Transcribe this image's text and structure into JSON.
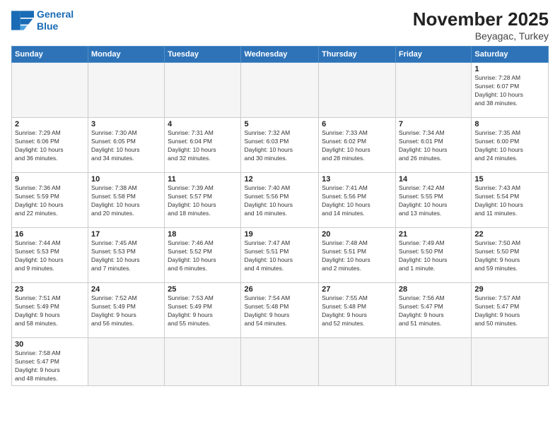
{
  "logo": {
    "line1": "General",
    "line2": "Blue"
  },
  "title": "November 2025",
  "location": "Beyagac, Turkey",
  "weekdays": [
    "Sunday",
    "Monday",
    "Tuesday",
    "Wednesday",
    "Thursday",
    "Friday",
    "Saturday"
  ],
  "weeks": [
    [
      {
        "day": "",
        "info": ""
      },
      {
        "day": "",
        "info": ""
      },
      {
        "day": "",
        "info": ""
      },
      {
        "day": "",
        "info": ""
      },
      {
        "day": "",
        "info": ""
      },
      {
        "day": "",
        "info": ""
      },
      {
        "day": "1",
        "info": "Sunrise: 7:28 AM\nSunset: 6:07 PM\nDaylight: 10 hours\nand 38 minutes."
      }
    ],
    [
      {
        "day": "2",
        "info": "Sunrise: 7:29 AM\nSunset: 6:06 PM\nDaylight: 10 hours\nand 36 minutes."
      },
      {
        "day": "3",
        "info": "Sunrise: 7:30 AM\nSunset: 6:05 PM\nDaylight: 10 hours\nand 34 minutes."
      },
      {
        "day": "4",
        "info": "Sunrise: 7:31 AM\nSunset: 6:04 PM\nDaylight: 10 hours\nand 32 minutes."
      },
      {
        "day": "5",
        "info": "Sunrise: 7:32 AM\nSunset: 6:03 PM\nDaylight: 10 hours\nand 30 minutes."
      },
      {
        "day": "6",
        "info": "Sunrise: 7:33 AM\nSunset: 6:02 PM\nDaylight: 10 hours\nand 28 minutes."
      },
      {
        "day": "7",
        "info": "Sunrise: 7:34 AM\nSunset: 6:01 PM\nDaylight: 10 hours\nand 26 minutes."
      },
      {
        "day": "8",
        "info": "Sunrise: 7:35 AM\nSunset: 6:00 PM\nDaylight: 10 hours\nand 24 minutes."
      }
    ],
    [
      {
        "day": "9",
        "info": "Sunrise: 7:36 AM\nSunset: 5:59 PM\nDaylight: 10 hours\nand 22 minutes."
      },
      {
        "day": "10",
        "info": "Sunrise: 7:38 AM\nSunset: 5:58 PM\nDaylight: 10 hours\nand 20 minutes."
      },
      {
        "day": "11",
        "info": "Sunrise: 7:39 AM\nSunset: 5:57 PM\nDaylight: 10 hours\nand 18 minutes."
      },
      {
        "day": "12",
        "info": "Sunrise: 7:40 AM\nSunset: 5:56 PM\nDaylight: 10 hours\nand 16 minutes."
      },
      {
        "day": "13",
        "info": "Sunrise: 7:41 AM\nSunset: 5:56 PM\nDaylight: 10 hours\nand 14 minutes."
      },
      {
        "day": "14",
        "info": "Sunrise: 7:42 AM\nSunset: 5:55 PM\nDaylight: 10 hours\nand 13 minutes."
      },
      {
        "day": "15",
        "info": "Sunrise: 7:43 AM\nSunset: 5:54 PM\nDaylight: 10 hours\nand 11 minutes."
      }
    ],
    [
      {
        "day": "16",
        "info": "Sunrise: 7:44 AM\nSunset: 5:53 PM\nDaylight: 10 hours\nand 9 minutes."
      },
      {
        "day": "17",
        "info": "Sunrise: 7:45 AM\nSunset: 5:53 PM\nDaylight: 10 hours\nand 7 minutes."
      },
      {
        "day": "18",
        "info": "Sunrise: 7:46 AM\nSunset: 5:52 PM\nDaylight: 10 hours\nand 6 minutes."
      },
      {
        "day": "19",
        "info": "Sunrise: 7:47 AM\nSunset: 5:51 PM\nDaylight: 10 hours\nand 4 minutes."
      },
      {
        "day": "20",
        "info": "Sunrise: 7:48 AM\nSunset: 5:51 PM\nDaylight: 10 hours\nand 2 minutes."
      },
      {
        "day": "21",
        "info": "Sunrise: 7:49 AM\nSunset: 5:50 PM\nDaylight: 10 hours\nand 1 minute."
      },
      {
        "day": "22",
        "info": "Sunrise: 7:50 AM\nSunset: 5:50 PM\nDaylight: 9 hours\nand 59 minutes."
      }
    ],
    [
      {
        "day": "23",
        "info": "Sunrise: 7:51 AM\nSunset: 5:49 PM\nDaylight: 9 hours\nand 58 minutes."
      },
      {
        "day": "24",
        "info": "Sunrise: 7:52 AM\nSunset: 5:49 PM\nDaylight: 9 hours\nand 56 minutes."
      },
      {
        "day": "25",
        "info": "Sunrise: 7:53 AM\nSunset: 5:49 PM\nDaylight: 9 hours\nand 55 minutes."
      },
      {
        "day": "26",
        "info": "Sunrise: 7:54 AM\nSunset: 5:48 PM\nDaylight: 9 hours\nand 54 minutes."
      },
      {
        "day": "27",
        "info": "Sunrise: 7:55 AM\nSunset: 5:48 PM\nDaylight: 9 hours\nand 52 minutes."
      },
      {
        "day": "28",
        "info": "Sunrise: 7:56 AM\nSunset: 5:47 PM\nDaylight: 9 hours\nand 51 minutes."
      },
      {
        "day": "29",
        "info": "Sunrise: 7:57 AM\nSunset: 5:47 PM\nDaylight: 9 hours\nand 50 minutes."
      }
    ],
    [
      {
        "day": "30",
        "info": "Sunrise: 7:58 AM\nSunset: 5:47 PM\nDaylight: 9 hours\nand 48 minutes."
      },
      {
        "day": "",
        "info": ""
      },
      {
        "day": "",
        "info": ""
      },
      {
        "day": "",
        "info": ""
      },
      {
        "day": "",
        "info": ""
      },
      {
        "day": "",
        "info": ""
      },
      {
        "day": "",
        "info": ""
      }
    ]
  ]
}
